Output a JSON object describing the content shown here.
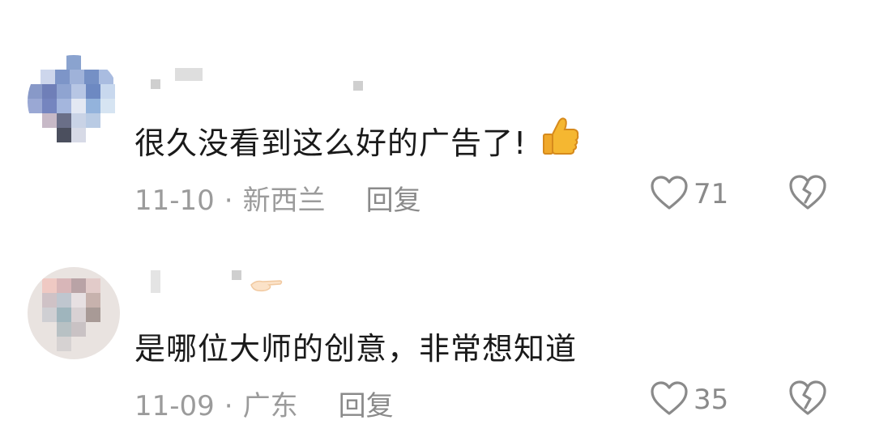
{
  "comments": [
    {
      "text": "很久没看到这么好的广告了!",
      "emoji": "thumbs-up",
      "date": "11-10",
      "separator": "·",
      "location": "新西兰",
      "reply_label": "回复",
      "likes": "71",
      "like_icon": "heart-outline-icon",
      "dislike_icon": "broken-heart-icon"
    },
    {
      "text": "是哪位大师的创意，非常想知道",
      "emoji": "pointing-hand",
      "date": "11-09",
      "separator": "·",
      "location": "广东",
      "reply_label": "回复",
      "likes": "35",
      "like_icon": "heart-outline-icon",
      "dislike_icon": "broken-heart-icon"
    }
  ],
  "colors": {
    "text": "#1a1a1a",
    "meta": "#9b9b9b",
    "icon": "#8a8a8a",
    "thumb": "#f5b731"
  }
}
